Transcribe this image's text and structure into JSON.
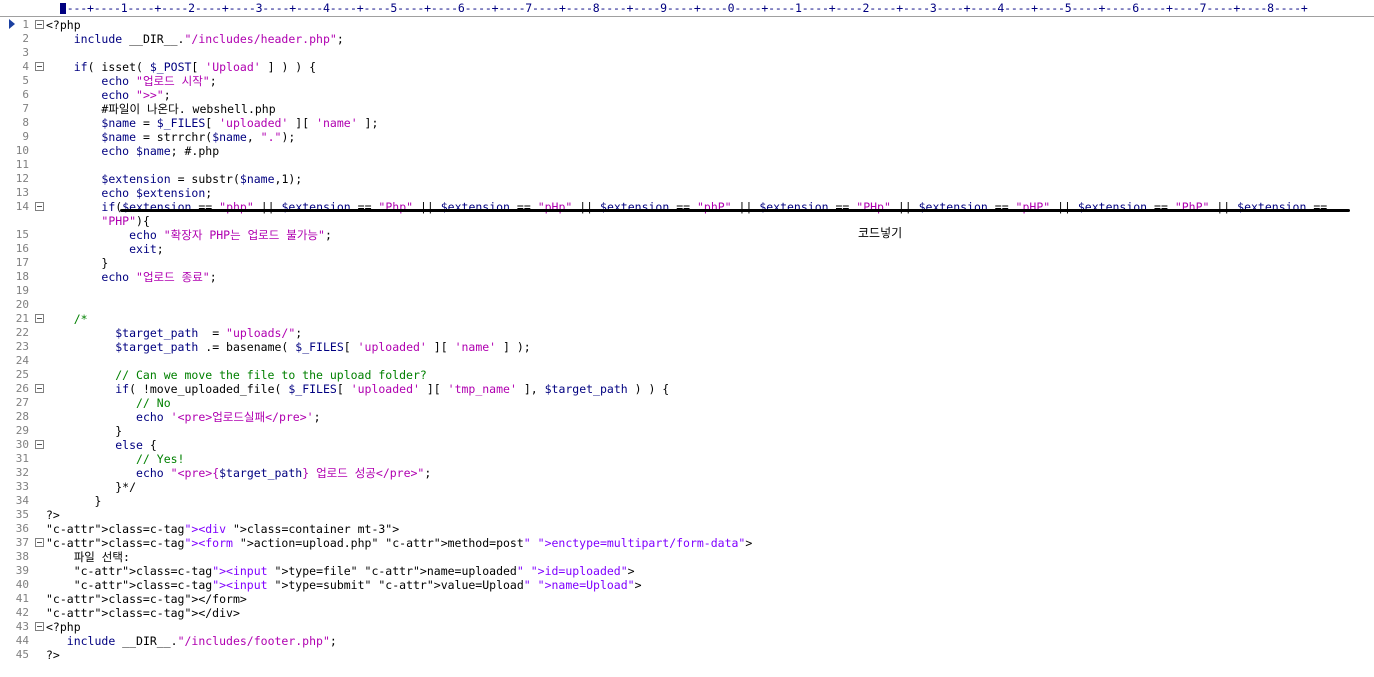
{
  "ruler": {
    "text": "----+----1----+----2----+----3----+----4----+----5----+----6----+----7----+----8----+----9----+----0----+----1----+----2----+----3----+----4----+----5----+----6----+----7----+----8----+"
  },
  "annotation": {
    "text": "코드넣기"
  },
  "code_lines": [
    {
      "n": "1",
      "fold": "open",
      "t": "<?php"
    },
    {
      "n": "2",
      "t": "    include __DIR__.\"/includes/header.php\";"
    },
    {
      "n": "3",
      "t": ""
    },
    {
      "n": "4",
      "fold": "open",
      "t": "    if( isset( $_POST[ 'Upload' ] ) ) {"
    },
    {
      "n": "5",
      "t": "        echo \"업로드 시작\";"
    },
    {
      "n": "6",
      "t": "        echo \">>\";"
    },
    {
      "n": "7",
      "t": "        #파일이 나온다. webshell.php"
    },
    {
      "n": "8",
      "t": "        $name = $_FILES[ 'uploaded' ][ 'name' ];"
    },
    {
      "n": "9",
      "t": "        $name = strrchr($name, \".\");"
    },
    {
      "n": "10",
      "t": "        echo $name; #.php"
    },
    {
      "n": "11",
      "t": ""
    },
    {
      "n": "12",
      "t": "        $extension = substr($name,1);"
    },
    {
      "n": "13",
      "t": "        echo $extension;"
    },
    {
      "n": "14",
      "fold": "open",
      "t": "        if($extension == \"php\" || $extension == \"Php\" || $extension == \"pHp\" || $extension == \"phP\" || $extension == \"PHp\" || $extension == \"pHP\" || $extension == \"PhP\" || $extension =="
    },
    {
      "n": "",
      "t": "        \"PHP\"){"
    },
    {
      "n": "15",
      "t": "            echo \"확장자 PHP는 업로드 불가능\";"
    },
    {
      "n": "16",
      "t": "            exit;"
    },
    {
      "n": "17",
      "t": "        }"
    },
    {
      "n": "18",
      "t": "        echo \"업로드 종료\";"
    },
    {
      "n": "19",
      "t": ""
    },
    {
      "n": "20",
      "t": ""
    },
    {
      "n": "21",
      "fold": "open",
      "t": "    /*"
    },
    {
      "n": "22",
      "t": "          $target_path  = \"uploads/\";"
    },
    {
      "n": "23",
      "t": "          $target_path .= basename( $_FILES[ 'uploaded' ][ 'name' ] );"
    },
    {
      "n": "24",
      "t": ""
    },
    {
      "n": "25",
      "t": "          // Can we move the file to the upload folder?"
    },
    {
      "n": "26",
      "fold": "open",
      "t": "          if( !move_uploaded_file( $_FILES[ 'uploaded' ][ 'tmp_name' ], $target_path ) ) {"
    },
    {
      "n": "27",
      "t": "             // No"
    },
    {
      "n": "28",
      "t": "             echo '<pre>업로드실패</pre>';"
    },
    {
      "n": "29",
      "t": "          }"
    },
    {
      "n": "30",
      "fold": "open",
      "t": "          else {"
    },
    {
      "n": "31",
      "t": "             // Yes!"
    },
    {
      "n": "32",
      "t": "             echo \"<pre>{$target_path} 업로드 성공</pre>\";"
    },
    {
      "n": "33",
      "t": "          }*/"
    },
    {
      "n": "34",
      "t": "       }"
    },
    {
      "n": "35",
      "t": "?>"
    },
    {
      "n": "36",
      "t": "<div class=\"container mt-3\">"
    },
    {
      "n": "37",
      "fold": "open",
      "t": "<form action=\"upload.php\" method=\"post\" enctype=\"multipart/form-data\">"
    },
    {
      "n": "38",
      "t": "    파일 선택:"
    },
    {
      "n": "39",
      "t": "    <input type=\"file\" name=\"uploaded\" id=\"uploaded\">"
    },
    {
      "n": "40",
      "t": "    <input type=\"submit\" value=\"Upload\" name=\"Upload\">"
    },
    {
      "n": "41",
      "t": "</form>"
    },
    {
      "n": "42",
      "t": "</div>"
    },
    {
      "n": "43",
      "fold": "open",
      "t": "<?php"
    },
    {
      "n": "44",
      "t": "   include __DIR__.\"/includes/footer.php\";"
    },
    {
      "n": "45",
      "t": "?>"
    }
  ]
}
